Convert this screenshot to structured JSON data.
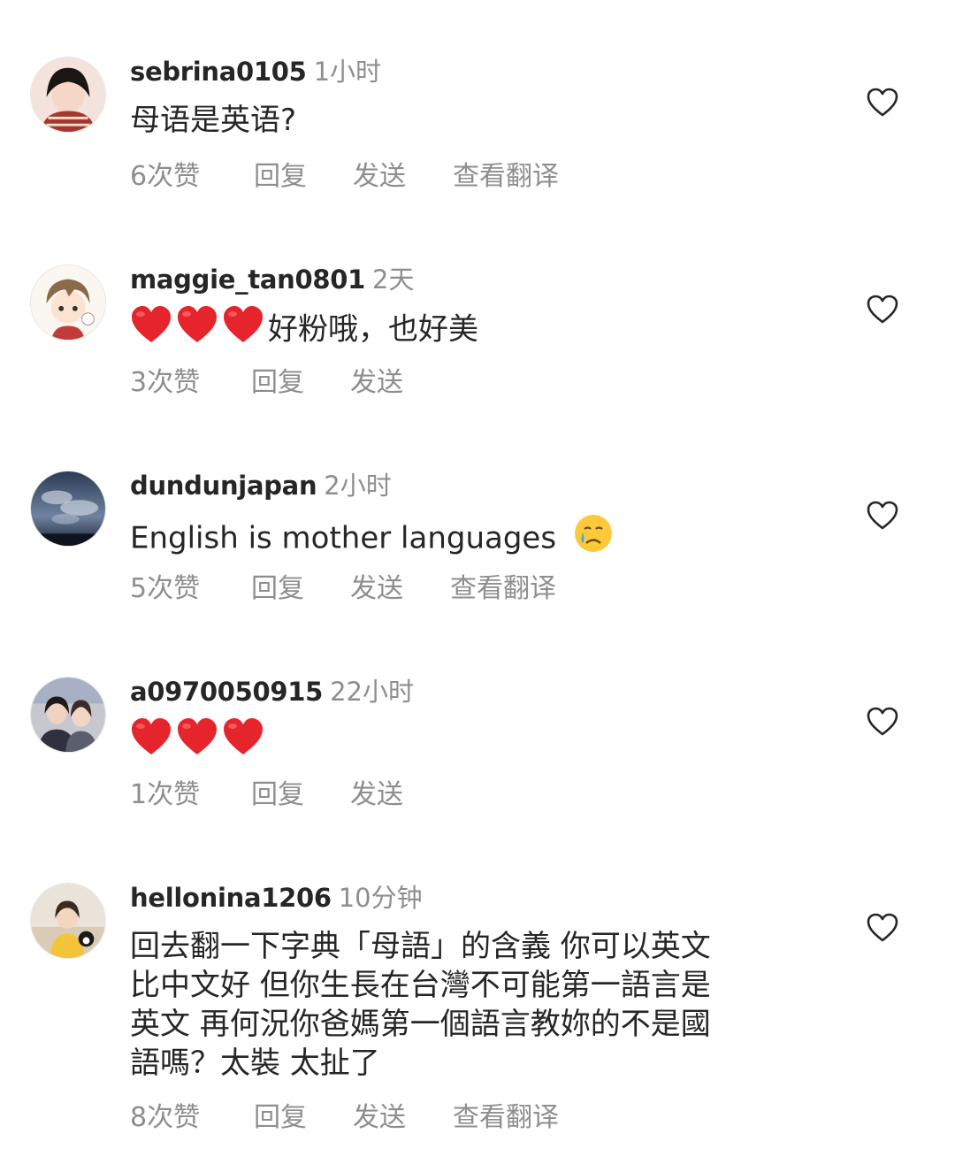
{
  "comments": [
    {
      "username": "sebrina0105",
      "time": "1小时",
      "text": "母语是英语?",
      "likes": "6次赞",
      "reply": "回复",
      "send": "发送",
      "translate": "查看翻译"
    },
    {
      "username": "maggie_tan0801",
      "time": "2天",
      "text": "好粉哦，也好美",
      "emoji": [
        "red-heart",
        "red-heart",
        "red-heart"
      ],
      "likes": "3次赞",
      "reply": "回复",
      "send": "发送"
    },
    {
      "username": "dundunjapan",
      "time": "2小时",
      "text": "English is mother languages",
      "emoji_after": "crying-face",
      "likes": "5次赞",
      "reply": "回复",
      "send": "发送",
      "translate": "查看翻译"
    },
    {
      "username": "a0970050915",
      "time": "22小时",
      "text": "",
      "emoji": [
        "red-heart",
        "red-heart",
        "red-heart"
      ],
      "likes": "1次赞",
      "reply": "回复",
      "send": "发送"
    },
    {
      "username": "hellonina1206",
      "time": "10分钟",
      "text_lines": [
        "回去翻一下字典「母語」的含義 你可以英文",
        "比中文好 但你生長在台灣不可能第一語言是",
        "英文 再何況你爸媽第一個語言教妳的不是國",
        "語嗎？太裝 太扯了"
      ],
      "likes": "8次赞",
      "reply": "回复",
      "send": "发送",
      "translate": "查看翻译"
    }
  ],
  "colors": {
    "text": "#262626",
    "muted": "#8e8e8e",
    "heart_emoji": "#e5242b",
    "like_outline": "#262626"
  },
  "icons": {
    "like": "heart-outline-icon"
  }
}
